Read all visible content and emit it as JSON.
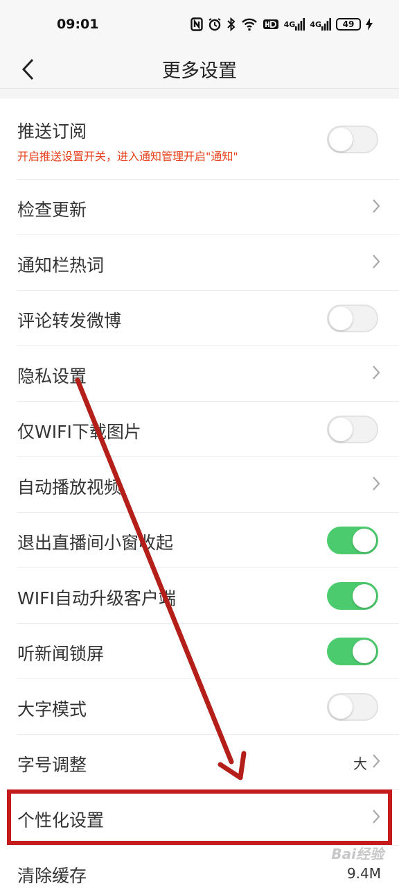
{
  "status_bar": {
    "time": "09:01",
    "signal_1": "4G",
    "signal_2": "4G",
    "battery": "49"
  },
  "header": {
    "title": "更多设置"
  },
  "settings": [
    {
      "label": "推送订阅",
      "sub": "开启推送设置开关，进入通知管理开启\"通知\"",
      "control": "toggle",
      "on": false
    },
    {
      "label": "检查更新",
      "control": "chevron"
    },
    {
      "label": "通知栏热词",
      "control": "chevron"
    },
    {
      "label": "评论转发微博",
      "control": "toggle",
      "on": false
    },
    {
      "label": "隐私设置",
      "control": "chevron"
    },
    {
      "label": "仅WIFI下载图片",
      "control": "toggle",
      "on": false
    },
    {
      "label": "自动播放视频",
      "control": "chevron"
    },
    {
      "label": "退出直播间小窗收起",
      "control": "toggle",
      "on": true
    },
    {
      "label": "WIFI自动升级客户端",
      "control": "toggle",
      "on": true
    },
    {
      "label": "听新闻锁屏",
      "control": "toggle",
      "on": true
    },
    {
      "label": "大字模式",
      "control": "toggle",
      "on": false
    },
    {
      "label": "字号调整",
      "value": "大",
      "control": "chevron"
    },
    {
      "label": "个性化设置",
      "control": "chevron"
    },
    {
      "label": "清除缓存",
      "value": "9.4M",
      "control": "value"
    }
  ],
  "watermark": "Bai经验",
  "colors": {
    "accent_on": "#4ccb6e",
    "warning_text": "#e8401c",
    "annotation": "#c41c1c"
  },
  "icons": [
    "back-arrow-icon",
    "chevron-right-icon",
    "nfc-icon",
    "alarm-icon",
    "bluetooth-icon",
    "wifi-icon",
    "hd-icon",
    "charging-icon"
  ]
}
